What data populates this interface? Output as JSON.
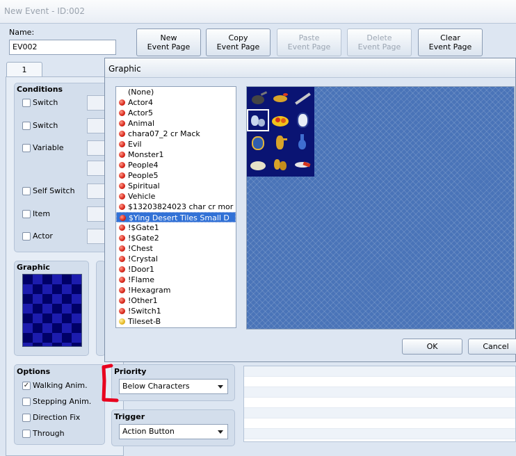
{
  "window": {
    "title": "New Event - ID:002"
  },
  "name_field": {
    "label": "Name:",
    "value": "EV002"
  },
  "page_buttons": [
    {
      "line1": "New",
      "line2": "Event Page",
      "enabled": true
    },
    {
      "line1": "Copy",
      "line2": "Event Page",
      "enabled": true
    },
    {
      "line1": "Paste",
      "line2": "Event Page",
      "enabled": false
    },
    {
      "line1": "Delete",
      "line2": "Event Page",
      "enabled": false
    },
    {
      "line1": "Clear",
      "line2": "Event Page",
      "enabled": true
    }
  ],
  "tab": {
    "label": "1"
  },
  "conditions": {
    "title": "Conditions",
    "items": [
      {
        "label": "Switch",
        "checked": false
      },
      {
        "label": "Switch",
        "checked": false
      },
      {
        "label": "Variable",
        "checked": false
      },
      {
        "label": "Self Switch",
        "checked": false
      },
      {
        "label": "Item",
        "checked": false
      },
      {
        "label": "Actor",
        "checked": false
      }
    ]
  },
  "graphic_group": {
    "title": "Graphic"
  },
  "options": {
    "title": "Options",
    "items": [
      {
        "label": "Walking Anim.",
        "checked": true
      },
      {
        "label": "Stepping Anim.",
        "checked": false
      },
      {
        "label": "Direction Fix",
        "checked": false
      },
      {
        "label": "Through",
        "checked": false
      }
    ]
  },
  "priority": {
    "title": "Priority",
    "value": "Below Characters"
  },
  "trigger": {
    "title": "Trigger",
    "value": "Action Button"
  },
  "dialog": {
    "title": "Graphic",
    "ok_label": "OK",
    "cancel_label": "Cancel",
    "selected_index": 12,
    "files": [
      {
        "name": "(None)",
        "icon": "none"
      },
      {
        "name": "Actor4",
        "icon": "red-dot"
      },
      {
        "name": "Actor5",
        "icon": "red-dot"
      },
      {
        "name": "Animal",
        "icon": "red-dot"
      },
      {
        "name": "chara07_2 cr Mack",
        "icon": "red-dot"
      },
      {
        "name": "Evil",
        "icon": "red-dot"
      },
      {
        "name": "Monster1",
        "icon": "red-dot"
      },
      {
        "name": "People4",
        "icon": "red-dot"
      },
      {
        "name": "People5",
        "icon": "red-dot"
      },
      {
        "name": "Spiritual",
        "icon": "red-dot"
      },
      {
        "name": "Vehicle",
        "icon": "red-dot"
      },
      {
        "name": "$13203824023 char cr mor",
        "icon": "red-dot"
      },
      {
        "name": "$Ying Desert Tiles Small D",
        "icon": "red-dot"
      },
      {
        "name": "!$Gate1",
        "icon": "red-dot"
      },
      {
        "name": "!$Gate2",
        "icon": "red-dot"
      },
      {
        "name": "!Chest",
        "icon": "red-dot"
      },
      {
        "name": "!Crystal",
        "icon": "red-dot"
      },
      {
        "name": "!Door1",
        "icon": "red-dot"
      },
      {
        "name": "!Flame",
        "icon": "red-dot"
      },
      {
        "name": "!Hexagram",
        "icon": "red-dot"
      },
      {
        "name": "!Other1",
        "icon": "red-dot"
      },
      {
        "name": "!Switch1",
        "icon": "red-dot"
      },
      {
        "name": "Tileset-B",
        "icon": "yellow-dot"
      }
    ],
    "tiles": [
      "teapot-icon",
      "lamp-icon",
      "flute-icon",
      "vase-set-icon",
      "fruit-bowl-icon",
      "blue-plate-icon",
      "jar-icon",
      "ewer-icon",
      "blue-bottle-icon",
      "rice-bowl-icon",
      "gourd-icon",
      "fish-icon"
    ],
    "selected_tile": 3
  },
  "colors": {
    "selection": "#3171d6",
    "annotation": "#e8001e",
    "preview_bg": "#4a74b8",
    "tileset_bg": "#0a1473"
  }
}
